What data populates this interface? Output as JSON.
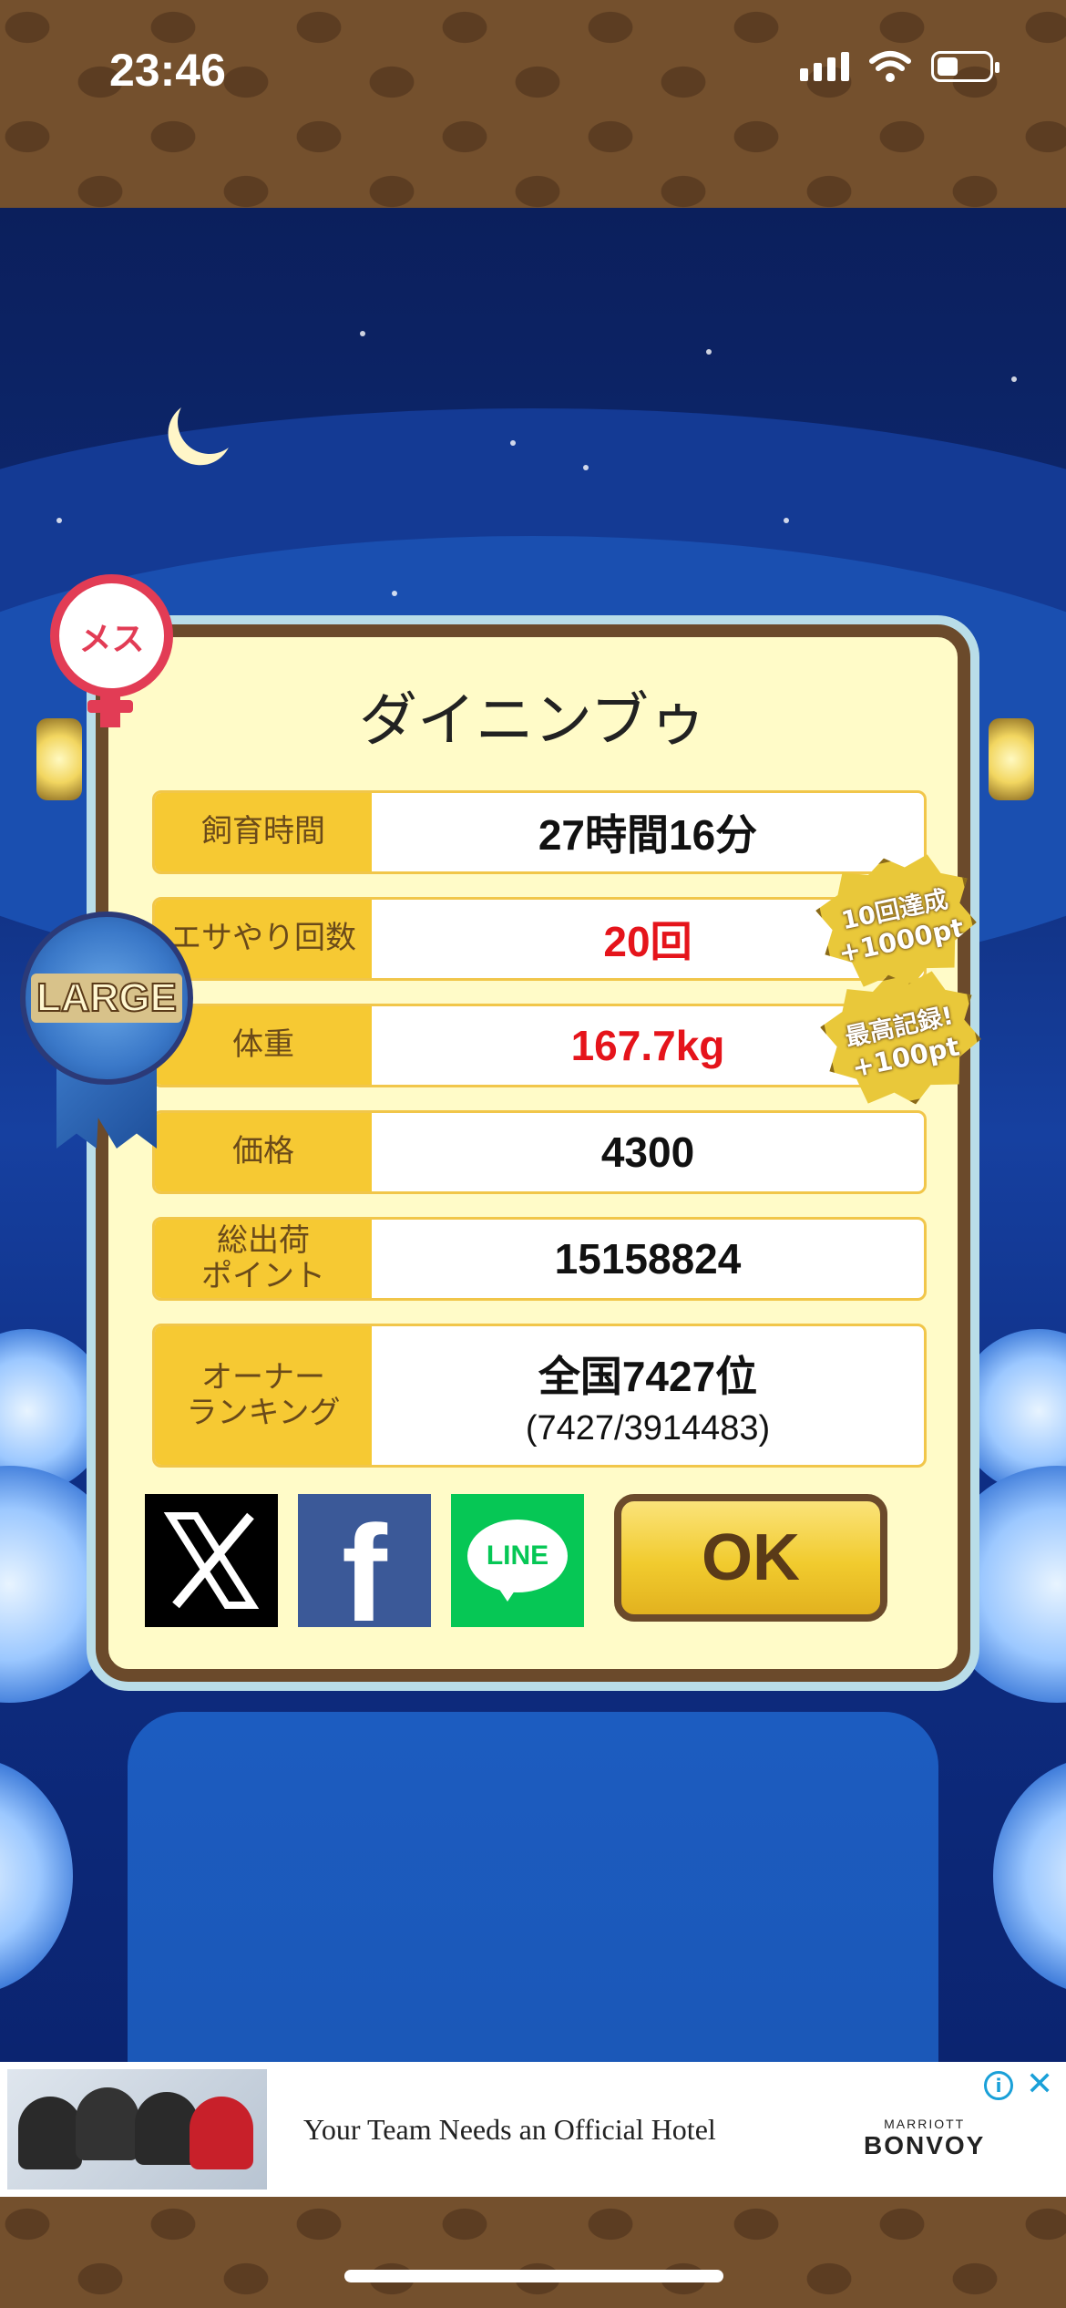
{
  "status_bar": {
    "time": "23:46"
  },
  "dialog": {
    "gender_badge": "メス",
    "size_ribbon": "LARGE",
    "pet_name": "ダイニンブゥ",
    "rows": [
      {
        "label": "飼育時間",
        "value": "27時間16分",
        "sub": "",
        "highlight": false
      },
      {
        "label": "エサやり回数",
        "value": "20回",
        "sub": "",
        "highlight": true
      },
      {
        "label": "体重",
        "value": "167.7kg",
        "sub": "",
        "highlight": true
      },
      {
        "label": "価格",
        "value": "4300",
        "sub": "",
        "highlight": false
      },
      {
        "label": "総出荷\nポイント",
        "value": "15158824",
        "sub": "",
        "highlight": false
      },
      {
        "label": "オーナー\nランキング",
        "value": "全国7427位",
        "sub": "(7427/3914483)",
        "highlight": false
      }
    ],
    "bonus_badges": [
      {
        "line1": "10回達成",
        "line2": "+1000pt"
      },
      {
        "line1": "最高記録!",
        "line2": "+100pt"
      }
    ],
    "share": {
      "x_icon": "x-logo-icon",
      "fb_label": "f",
      "line_label": "LINE"
    },
    "ok_label": "OK"
  },
  "ad": {
    "text": "Your Team Needs an Official Hotel",
    "brand_top": "MARRIOTT",
    "brand_main": "BONVOY",
    "info_label": "i",
    "close_label": "✕"
  }
}
